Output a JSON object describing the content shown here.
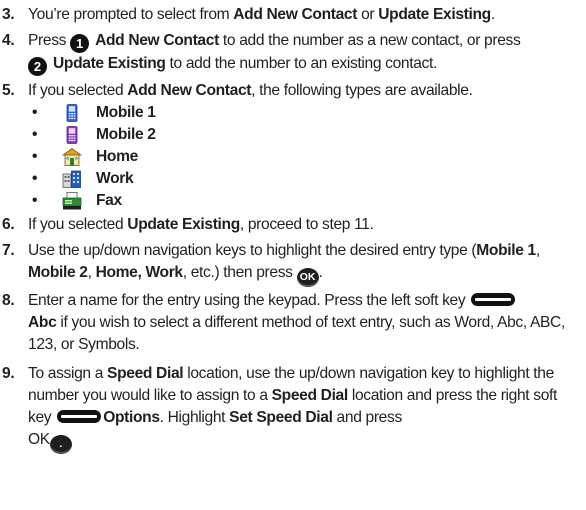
{
  "steps": [
    {
      "num": "3.",
      "p": [
        "You’re prompted to select from ",
        "Add New Contact",
        " or ",
        "Update Existing",
        "."
      ]
    },
    {
      "num": "4.",
      "p": [
        "Press ",
        "1",
        " ",
        "Add New Contact",
        " to add the number as a new contact, or press ",
        "2",
        " ",
        "Update Existing",
        " to add the number to an existing contact."
      ]
    },
    {
      "num": "5.",
      "p": [
        "If you selected ",
        "Add New Contact",
        ", the following types are available."
      ]
    },
    {
      "num": "6.",
      "p": [
        "If you selected ",
        "Update Existing",
        ", proceed to step 11."
      ]
    },
    {
      "num": "7.",
      "p": [
        "Use the up/down navigation keys to highlight the desired entry type (",
        "Mobile 1",
        ", ",
        "Mobile 2",
        ", ",
        "Home, Work",
        ", etc.) then press ",
        "OK",
        "."
      ]
    },
    {
      "num": "8.",
      "p": [
        "Enter a name for the entry using the keypad. Press the left soft key ",
        "Abc",
        " if you wish to select a different method of text entry, such as Word, Abc, ABC, 123, or Symbols."
      ]
    },
    {
      "num": "9.",
      "p": [
        "To assign a ",
        "Speed Dial",
        " location, use the up/down navigation key to highlight the number you would like to assign to a ",
        "Speed Dial",
        " location and press the right soft key ",
        "Options",
        ". Highlight ",
        "Set Speed Dial",
        " and press ",
        "OK",
        "."
      ]
    }
  ],
  "bullet_char": "•",
  "types": [
    {
      "label": "Mobile 1",
      "icon": "mobile-phone-blue-icon",
      "color": "#2f5fd6"
    },
    {
      "label": "Mobile 2",
      "icon": "mobile-phone-purple-icon",
      "color": "#8a3bb8"
    },
    {
      "label": "Home",
      "icon": "house-icon",
      "color": "#2d7f3b"
    },
    {
      "label": "Work",
      "icon": "office-building-icon",
      "color": "#1f5fbf"
    },
    {
      "label": "Fax",
      "icon": "fax-machine-icon",
      "color": "#2f8f2f"
    }
  ]
}
